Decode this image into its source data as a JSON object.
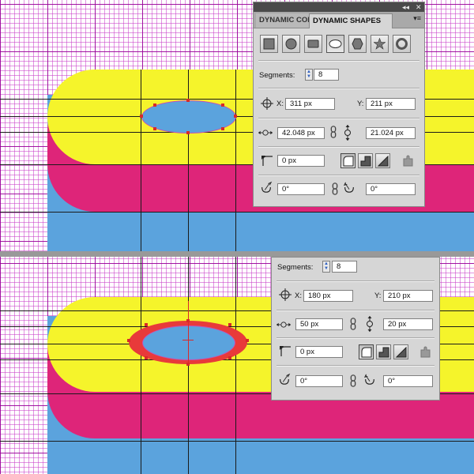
{
  "panel_top": {
    "tabs": [
      {
        "label": "DYNAMIC COR",
        "active": false
      },
      {
        "label": "DYNAMIC SHAPES",
        "active": true
      }
    ],
    "menu_glyph": "▾≡",
    "window_controls": "◂◂",
    "close_glyph": "✕",
    "shapes": [
      "rectangle-icon",
      "circle-icon",
      "rounded-rectangle-icon",
      "ellipse-icon",
      "hexagon-icon",
      "star-icon",
      "ring-icon"
    ],
    "selected_shape": "ellipse-icon",
    "segments_label": "Segments:",
    "segments_value": "8",
    "x_label": "X:",
    "x_value": "311 px",
    "y_label": "Y:",
    "y_value": "211 px",
    "width_value": "42.048 px",
    "height_value": "21.024 px",
    "corner_value": "0 px",
    "rotation_value": "0°",
    "skew_value": "0°"
  },
  "panel_bottom": {
    "segments_label": "Segments:",
    "segments_value": "8",
    "x_label": "X:",
    "x_value": "180 px",
    "y_label": "Y:",
    "y_value": "210 px",
    "width_value": "50 px",
    "height_value": "20 px",
    "corner_value": "0 px",
    "rotation_value": "0°",
    "skew_value": "0°"
  },
  "colors": {
    "yellow": "#f5f42b",
    "pink": "#de2579",
    "blue": "#5ba3dd",
    "red": "#e83a3a",
    "grid": "#b030b0"
  }
}
